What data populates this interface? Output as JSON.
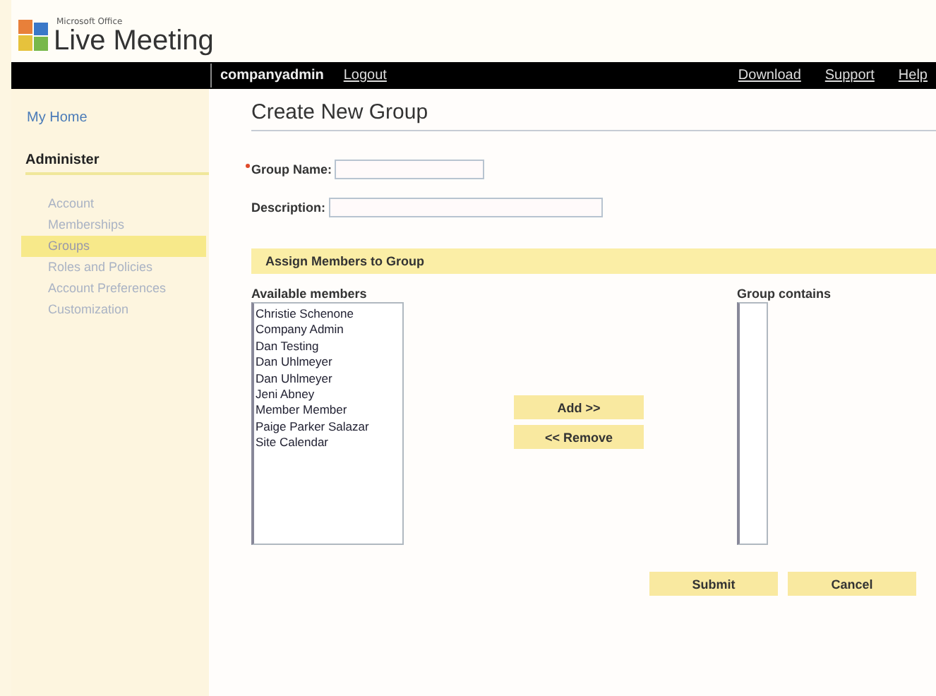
{
  "logo": {
    "brand": "Microsoft Office",
    "product": "Live Meeting"
  },
  "top_bar": {
    "user": "companyadmin",
    "logout": "Logout",
    "links": [
      "Download",
      "Support",
      "Help"
    ]
  },
  "sidebar": {
    "home": "My Home",
    "section": "Administer",
    "items": [
      {
        "label": "Account",
        "selected": false
      },
      {
        "label": "Memberships",
        "selected": false
      },
      {
        "label": "Groups",
        "selected": true
      },
      {
        "label": "Roles and Policies",
        "selected": false
      },
      {
        "label": "Account Preferences",
        "selected": false
      },
      {
        "label": "Customization",
        "selected": false
      }
    ]
  },
  "page_title": "Create New Group",
  "fields": [
    {
      "label": "Group Name:",
      "required": true,
      "kind": "short"
    },
    {
      "label": "Description:",
      "required": false,
      "kind": "long"
    }
  ],
  "assign_section": "Assign Members to Group",
  "available": {
    "label": "Available members",
    "items": [
      "Christie Schenone",
      "Company Admin",
      "Dan Testing",
      "Dan Uhlmeyer",
      "Dan Uhlmeyer",
      "Jeni Abney",
      "Member Member",
      "Paige Parker Salazar",
      "Site Calendar"
    ]
  },
  "move_buttons": [
    "Add >>",
    "<< Remove"
  ],
  "group_contains": {
    "label": "Group contains"
  },
  "buttons": [
    "Submit",
    "Cancel"
  ]
}
